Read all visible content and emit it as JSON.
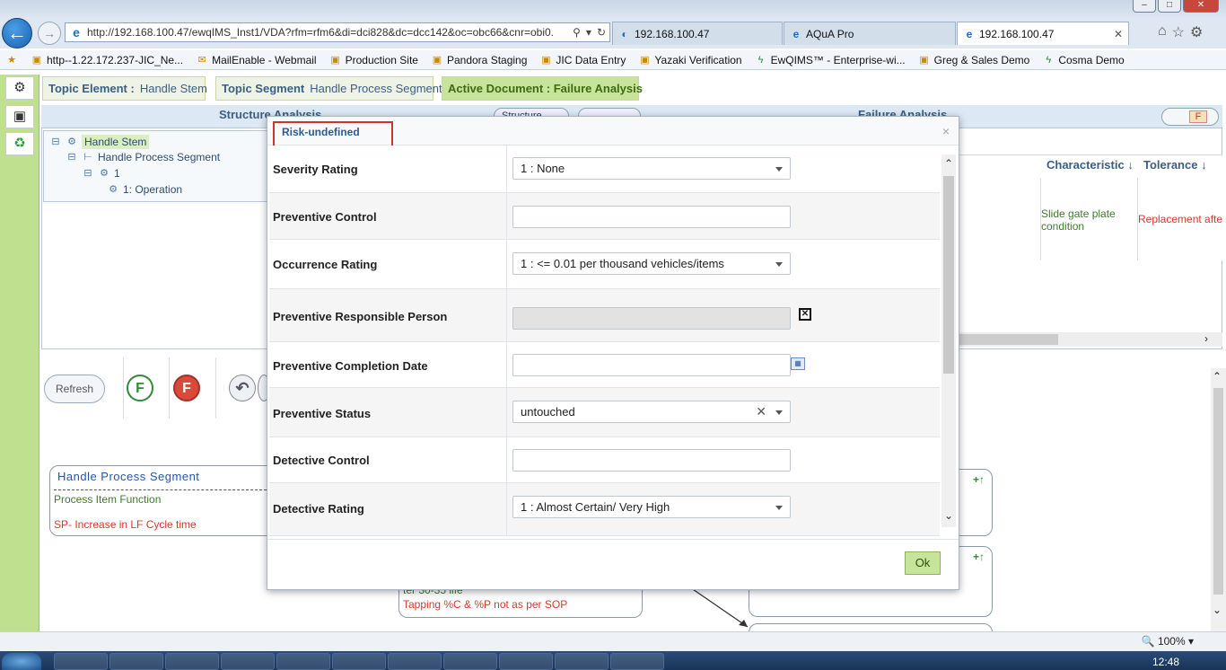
{
  "browser": {
    "address_url": "http://192.168.100.47/ewqIMS_Inst1/VDA?rfm=rfm6&di=dci828&dc=dcc142&oc=obc66&cnr=obi0.",
    "tabs": [
      {
        "label": "192.168.100.47",
        "active": false
      },
      {
        "label": "AQuA Pro",
        "active": false
      },
      {
        "label": "192.168.100.47",
        "active": true
      }
    ],
    "favorites": [
      "http--1.22.172.237-JIC_Ne...",
      "MailEnable - Webmail",
      "Production Site",
      "Pandora Staging",
      "JIC Data Entry",
      "Yazaki Verification",
      "EwQIMS™ - Enterprise-wi...",
      "Greg & Sales Demo",
      "Cosma Demo"
    ],
    "zoom": "100%",
    "clock": "12:48"
  },
  "header": {
    "topic_element_label": "Topic Element :",
    "topic_element_value": "Handle Stem",
    "topic_segment_label": "Topic Segment",
    "topic_segment_value": "Handle Process Segment",
    "active_document": "Active Document : Failure Analysis"
  },
  "structure": {
    "title": "Structure Analysis",
    "toggle_label": "Structure",
    "tree": [
      "Handle Stem",
      "Handle Process Segment",
      "1",
      "1: Operation"
    ]
  },
  "failure": {
    "title": "Failure Analysis",
    "f_badge": "F",
    "columns": [
      "Characteristic",
      "Tolerance"
    ],
    "row": {
      "characteristic": "Slide gate plate condition",
      "tolerance": "Replacement after"
    }
  },
  "toolbar": {
    "refresh": "Refresh",
    "f_green": "F",
    "f_red": "F"
  },
  "diagram": {
    "node1_title": "Handle Process Segment",
    "node1_func": "Process Item Function",
    "node1_fail": "SP- Increase in LF Cycle time",
    "node2_text1": "ter 30-35 life",
    "node2_text2": "Tapping %C & %P not as per SOP"
  },
  "modal": {
    "title": "Risk-undefined",
    "close": "×",
    "rows": [
      {
        "label": "Severity Rating",
        "value": "1 : None",
        "type": "select"
      },
      {
        "label": "Preventive Control",
        "value": "",
        "type": "text"
      },
      {
        "label": "Occurrence Rating",
        "value": "1 : <= 0.01 per thousand vehicles/items",
        "type": "select"
      },
      {
        "label": "Preventive Responsible Person",
        "value": "",
        "type": "disabled"
      },
      {
        "label": "Preventive Completion Date",
        "value": "",
        "type": "date"
      },
      {
        "label": "Preventive Status",
        "value": "untouched",
        "type": "select-clear"
      },
      {
        "label": "Detective Control",
        "value": "",
        "type": "text"
      },
      {
        "label": "Detective Rating",
        "value": "1 : Almost Certain/ Very High",
        "type": "select"
      }
    ],
    "ok": "Ok"
  }
}
